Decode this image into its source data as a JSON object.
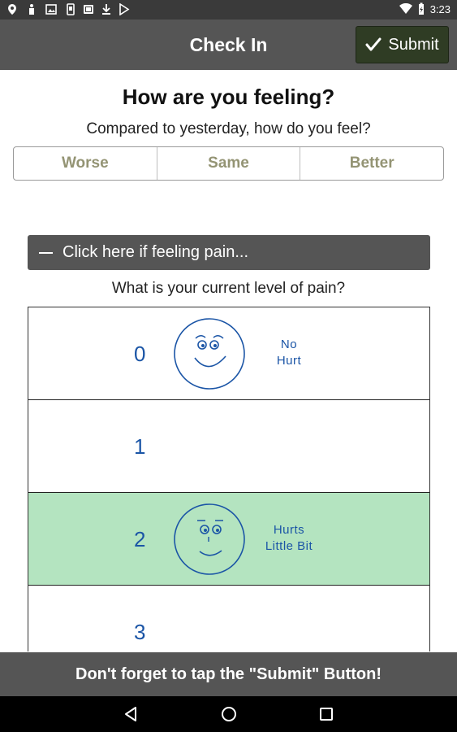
{
  "status_bar": {
    "time": "3:23",
    "left_icons": [
      "location-icon",
      "accessibility-icon",
      "image-icon",
      "phone-icon",
      "photo-icon",
      "download-icon",
      "play-store-icon"
    ],
    "right_icons": [
      "wifi-icon",
      "battery-charging-icon"
    ]
  },
  "app_bar": {
    "title": "Check In",
    "submit_label": "Submit"
  },
  "feeling": {
    "heading": "How are you feeling?",
    "question": "Compared to yesterday, how do you feel?",
    "options": [
      "Worse",
      "Same",
      "Better"
    ]
  },
  "pain": {
    "toggle_label": "Click here if feeling pain...",
    "question": "What is your current level of pain?",
    "levels": [
      {
        "value": "0",
        "desc_line1": "No",
        "desc_line2": "Hurt",
        "selected": false
      },
      {
        "value": "1",
        "desc_line1": "",
        "desc_line2": "",
        "selected": false
      },
      {
        "value": "2",
        "desc_line1": "Hurts",
        "desc_line2": "Little Bit",
        "selected": true
      },
      {
        "value": "3",
        "desc_line1": "",
        "desc_line2": "",
        "selected": false
      }
    ]
  },
  "footer": {
    "reminder": "Don't forget to tap the \"Submit\" Button!"
  },
  "nav": [
    "back-icon",
    "home-icon",
    "recents-icon"
  ],
  "colors": {
    "bar": "#555555",
    "submit_bg": "#2f3c24",
    "selected_row": "#b4e4c0",
    "pain_text": "#1b55a6",
    "option_text": "#949474"
  }
}
